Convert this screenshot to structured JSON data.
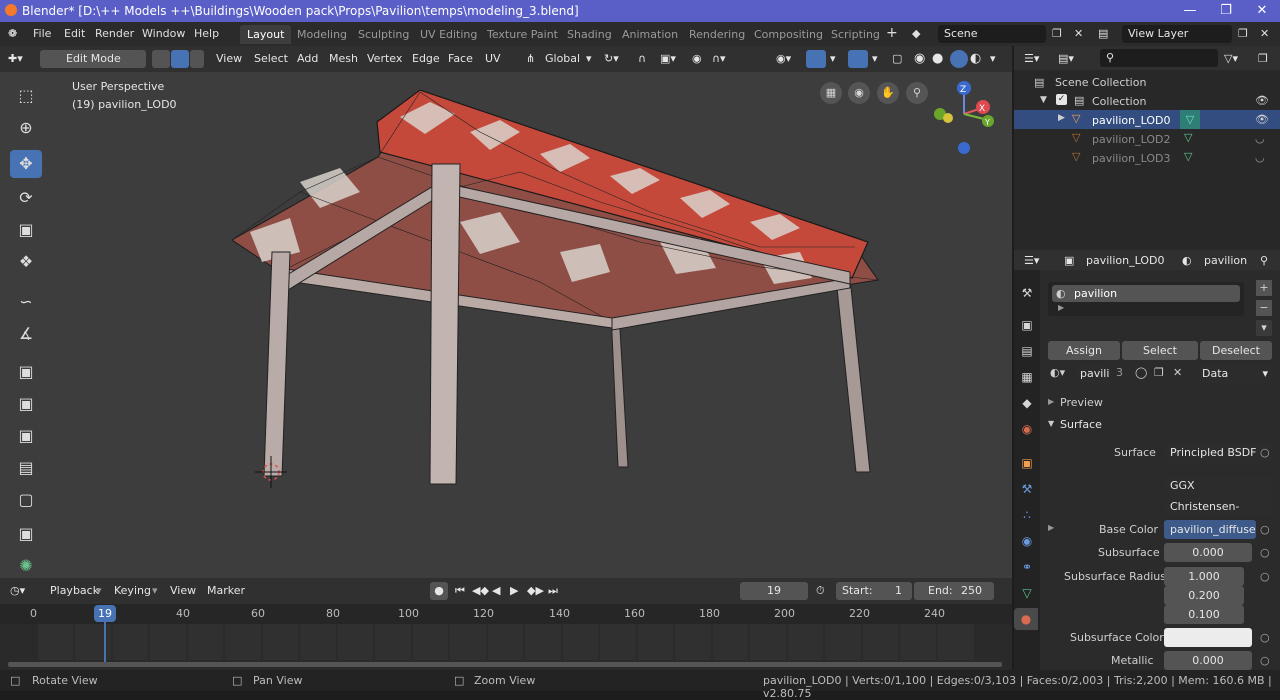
{
  "titlebar": {
    "title": "Blender* [D:\\++ Models ++\\Buildings\\Wooden pack\\Props\\Pavilion\\temps\\modeling_3.blend]"
  },
  "menu": [
    "File",
    "Edit",
    "Render",
    "Window",
    "Help"
  ],
  "workspaces": [
    "Layout",
    "Modeling",
    "Sculpting",
    "UV Editing",
    "Texture Paint",
    "Shading",
    "Animation",
    "Rendering",
    "Compositing",
    "Scripting"
  ],
  "scene": "Scene",
  "view_layer": "View Layer",
  "viewport_header": {
    "mode": "Edit Mode",
    "menus": [
      "View",
      "Select",
      "Add",
      "Mesh",
      "Vertex",
      "Edge",
      "Face",
      "UV"
    ],
    "orientation": "Global"
  },
  "viewport": {
    "view_name": "User Perspective",
    "object_label": "(19) pavilion_LOD0"
  },
  "gizmo": {
    "z": "Z",
    "x": "X",
    "y": "Y"
  },
  "outliner": {
    "root": "Scene Collection",
    "collection": "Collection",
    "items": [
      {
        "label": "pavilion_LOD0",
        "selected": true
      },
      {
        "label": "pavilion_LOD2",
        "selected": false
      },
      {
        "label": "pavilion_LOD3",
        "selected": false
      }
    ]
  },
  "props": {
    "object": "pavilion_LOD0",
    "material": "pavilion",
    "slot": "pavilion",
    "buttons": [
      "Assign",
      "Select",
      "Deselect"
    ],
    "mat_short": "pavili",
    "users": "3",
    "link": "Data",
    "sections": {
      "preview": "Preview",
      "surface": "Surface"
    },
    "surface_label": "Surface",
    "surface_value": "Principled BSDF",
    "distribution": "GGX",
    "subsurface_method": "Christensen-Burley",
    "fields": [
      {
        "label": "Base Color",
        "value": "pavilion_diffuse..."
      },
      {
        "label": "Subsurface",
        "value": "0.000"
      },
      {
        "label": "Subsurface Radius",
        "value": "1.000"
      },
      {
        "label": "",
        "value": "0.200"
      },
      {
        "label": "",
        "value": "0.100"
      },
      {
        "label": "Subsurface Color",
        "value": ""
      },
      {
        "label": "Metallic",
        "value": "0.000"
      }
    ]
  },
  "timeline": {
    "menus": [
      "Playback",
      "Keying",
      "View",
      "Marker"
    ],
    "current_frame": "19",
    "start_label": "Start:",
    "start": "1",
    "end_label": "End:",
    "end": "250",
    "ruler": [
      "0",
      "19",
      "40",
      "60",
      "80",
      "100",
      "120",
      "140",
      "160",
      "180",
      "200",
      "220",
      "240"
    ]
  },
  "statusbar": {
    "rotate": "Rotate View",
    "pan": "Pan View",
    "zoom": "Zoom View",
    "stats": "pavilion_LOD0 | Verts:0/1,100 | Edges:0/3,103 | Faces:0/2,003 | Tris:2,200 | Mem: 160.6 MB | v2.80.75"
  },
  "colors": {
    "accent": "#4772b3",
    "titlebar": "#5a5fc7",
    "roof_red": "#c44a3c",
    "roof_white": "#d9d2cc"
  }
}
